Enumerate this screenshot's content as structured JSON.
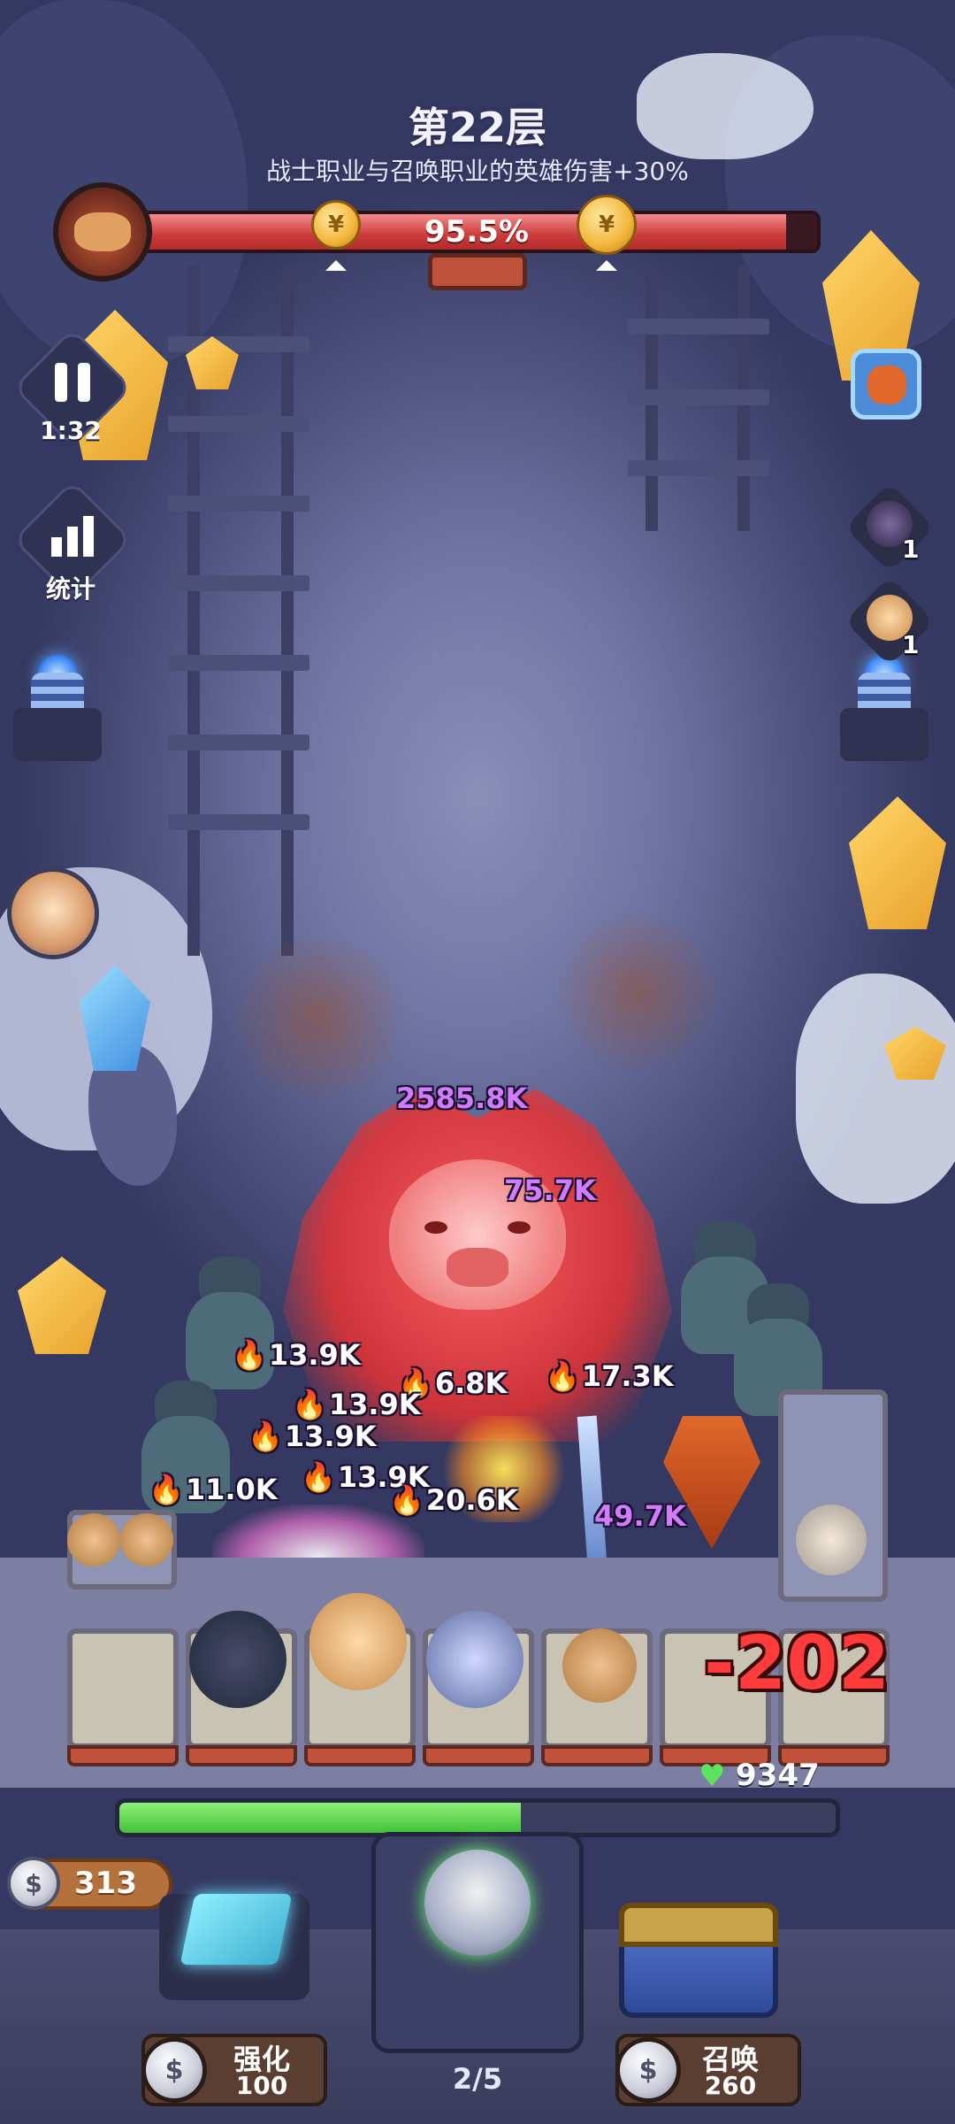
{
  "level": {
    "title": "第22层",
    "buff": "战士职业与召唤职业的英雄伤害+30%"
  },
  "boss_bar": {
    "percent_text": "95.5%",
    "fill_fraction": 0.955
  },
  "left_buttons": {
    "pause_time": "1:32",
    "stats_label": "统计"
  },
  "right_panel": {
    "queue_counts": [
      "1",
      "1"
    ]
  },
  "damage_numbers": [
    {
      "text": "2585.8K",
      "color": "purple",
      "fire": false
    },
    {
      "text": "75.7K",
      "color": "purple",
      "fire": false
    },
    {
      "text": "13.9K",
      "color": "white",
      "fire": true
    },
    {
      "text": "6.8K",
      "color": "white",
      "fire": true
    },
    {
      "text": "17.3K",
      "color": "white",
      "fire": true
    },
    {
      "text": "13.9K",
      "color": "white",
      "fire": true
    },
    {
      "text": "13.9K",
      "color": "white",
      "fire": true
    },
    {
      "text": "13.9K",
      "color": "white",
      "fire": true
    },
    {
      "text": "11.0K",
      "color": "white",
      "fire": true
    },
    {
      "text": "20.6K",
      "color": "white",
      "fire": true
    },
    {
      "text": "49.7K",
      "color": "purple",
      "fire": false
    }
  ],
  "player": {
    "damage_taken": "-202",
    "hp_value": "9347",
    "hp_fraction": 0.56
  },
  "currency": {
    "silver_coins": "313"
  },
  "actions": {
    "upgrade_label": "强化",
    "upgrade_cost": "100",
    "wave_progress": "2/5",
    "summon_label": "召唤",
    "summon_cost": "260"
  },
  "colors": {
    "boss_hp": "#cc3a3a",
    "player_hp": "#43c23a",
    "damage_purple": "#d37bff",
    "damage_red": "#ff3b3b"
  }
}
